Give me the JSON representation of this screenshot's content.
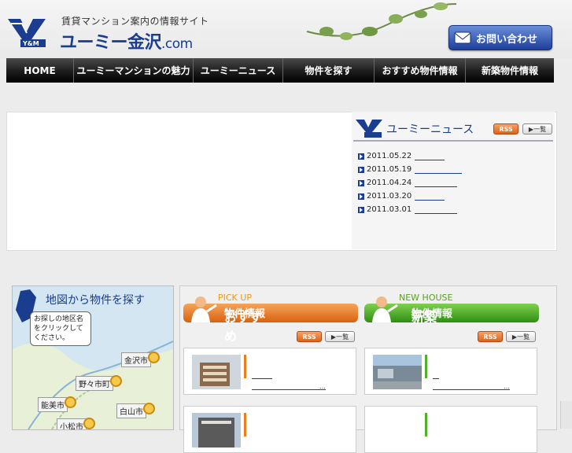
{
  "header": {
    "tagline": "賃貸マンション案内の情報サイト",
    "site_name": "ユーミー金沢",
    "site_suffix": ".com",
    "logo_text": "Y&M",
    "contact_label": "お問い合わせ"
  },
  "nav": [
    {
      "label": "HOME"
    },
    {
      "label": "ユーミーマンションの魅力"
    },
    {
      "label": "ユーミーニュース"
    },
    {
      "label": "物件を探す"
    },
    {
      "label": "おすすめ物件情報"
    },
    {
      "label": "新築物件情報"
    }
  ],
  "news": {
    "title": "ユーミーニュース",
    "rss_label": "RSS",
    "list_label": "▶一覧",
    "items": [
      {
        "date": "2011.05.22"
      },
      {
        "date": "2011.05.19"
      },
      {
        "date": "2011.04.24"
      },
      {
        "date": "2011.03.20"
      },
      {
        "date": "2011.03.01"
      }
    ]
  },
  "map": {
    "title": "地図から物件を探す",
    "bubble_text": "お探しの地区名をクリックしてください。",
    "cities": [
      {
        "name": "金沢市"
      },
      {
        "name": "野々市町"
      },
      {
        "name": "能美市"
      },
      {
        "name": "白山市"
      },
      {
        "name": "小松市"
      }
    ]
  },
  "recommend": {
    "tag": "PICK UP",
    "title_main": "おすすめ",
    "title_sub": "物件情報",
    "rss_label": "RSS",
    "list_label": "▶一覧",
    "link_more": "…"
  },
  "newbuild": {
    "tag": "NEW HOUSE",
    "title_main": "新築",
    "title_sub": "物件情報",
    "rss_label": "RSS",
    "list_label": "▶一覧",
    "link_more": "…"
  },
  "colors": {
    "brand_blue": "#1a3d8f",
    "accent_orange": "#e06218",
    "accent_green": "#3aa01e"
  }
}
